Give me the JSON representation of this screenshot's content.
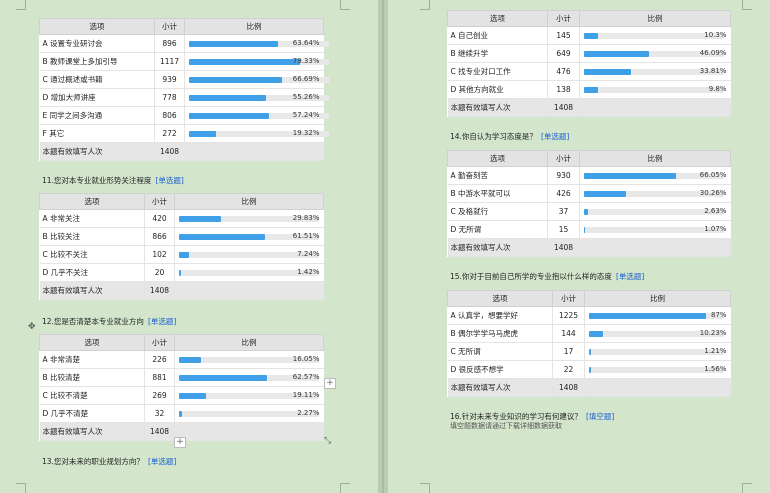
{
  "colors": {
    "bar": "#3fa0e8",
    "background": "#d3e6cc",
    "header": "#e3e3e3"
  },
  "headers": {
    "option": "选项",
    "count": "小计",
    "ratio": "比例"
  },
  "q10": {
    "rows": [
      {
        "label": "A 设置专业研讨会",
        "count": "896",
        "pct": "63.64%",
        "fill": 0.6364
      },
      {
        "label": "B 教师课堂上多加引导",
        "count": "1117",
        "pct": "79.33%",
        "fill": 0.7933
      },
      {
        "label": "C 通过概述或书籍",
        "count": "939",
        "pct": "66.69%",
        "fill": 0.6669
      },
      {
        "label": "D 增加大师讲座",
        "count": "778",
        "pct": "55.26%",
        "fill": 0.5526
      },
      {
        "label": "E 同学之间多沟通",
        "count": "806",
        "pct": "57.24%",
        "fill": 0.5724
      },
      {
        "label": "F 其它",
        "count": "272",
        "pct": "19.32%",
        "fill": 0.1932
      }
    ],
    "total_label": "本题有效填写人次",
    "total": "1408"
  },
  "q11": {
    "title": "11.您对本专业就业形势关注程度",
    "tag": "[单选题]",
    "rows": [
      {
        "label": "A 非常关注",
        "count": "420",
        "pct": "29.83%",
        "fill": 0.2983
      },
      {
        "label": "B 比较关注",
        "count": "866",
        "pct": "61.51%",
        "fill": 0.6151
      },
      {
        "label": "C 比较不关注",
        "count": "102",
        "pct": "7.24%",
        "fill": 0.0724
      },
      {
        "label": "D 几乎不关注",
        "count": "20",
        "pct": "1.42%",
        "fill": 0.0142
      }
    ],
    "total_label": "本题有效填写人次",
    "total": "1408"
  },
  "q12": {
    "title": "12.您是否清楚本专业就业方向",
    "tag": "[单选题]",
    "rows": [
      {
        "label": "A 非常清楚",
        "count": "226",
        "pct": "16.05%",
        "fill": 0.1605
      },
      {
        "label": "B 比较清楚",
        "count": "881",
        "pct": "62.57%",
        "fill": 0.6257
      },
      {
        "label": "C 比较不清楚",
        "count": "269",
        "pct": "19.11%",
        "fill": 0.1911
      },
      {
        "label": "D 几乎不清楚",
        "count": "32",
        "pct": "2.27%",
        "fill": 0.0227
      }
    ],
    "total_label": "本题有效填写人次",
    "total": "1408"
  },
  "q13": {
    "title": "13.您对未来的职业规划方向？",
    "tag": "[单选题]"
  },
  "q13_table": {
    "rows": [
      {
        "label": "A 自己创业",
        "count": "145",
        "pct": "10.3%",
        "fill": 0.103
      },
      {
        "label": "B 继续升学",
        "count": "649",
        "pct": "46.09%",
        "fill": 0.4609
      },
      {
        "label": "C 找专业对口工作",
        "count": "476",
        "pct": "33.81%",
        "fill": 0.3381
      },
      {
        "label": "D 其他方向就业",
        "count": "138",
        "pct": "9.8%",
        "fill": 0.098
      }
    ],
    "total_label": "本题有效填写人次",
    "total": "1408"
  },
  "q14": {
    "title": "14.你自认为学习态度是？",
    "tag": "[单选题]",
    "rows": [
      {
        "label": "A 勤奋刻苦",
        "count": "930",
        "pct": "66.05%",
        "fill": 0.6605
      },
      {
        "label": "B 中游水平就可以",
        "count": "426",
        "pct": "30.26%",
        "fill": 0.3026
      },
      {
        "label": "C 及格就行",
        "count": "37",
        "pct": "2.63%",
        "fill": 0.0263
      },
      {
        "label": "D 无所谓",
        "count": "15",
        "pct": "1.07%",
        "fill": 0.0107
      }
    ],
    "total_label": "本题有效填写人次",
    "total": "1408"
  },
  "q15": {
    "title": "15.你对于目前自己所学的专业抱以什么样的态度",
    "tag": "[单选题]",
    "rows": [
      {
        "label": "A 认真学，想要学好",
        "count": "1225",
        "pct": "87%",
        "fill": 0.87
      },
      {
        "label": "B 偶尔学学马马虎虎",
        "count": "144",
        "pct": "10.23%",
        "fill": 0.1023
      },
      {
        "label": "C 无所谓",
        "count": "17",
        "pct": "1.21%",
        "fill": 0.0121
      },
      {
        "label": "D 很反感不想学",
        "count": "22",
        "pct": "1.56%",
        "fill": 0.0156
      }
    ],
    "total_label": "本题有效填写人次",
    "total": "1408"
  },
  "q16": {
    "title": "16.针对未来专业知识的学习有何建议？",
    "tag": "[填空题]",
    "note": "填空题数据请通过下载详细数据获取"
  },
  "ui": {
    "plus": "+",
    "move": "✥",
    "resize": "⤡"
  }
}
